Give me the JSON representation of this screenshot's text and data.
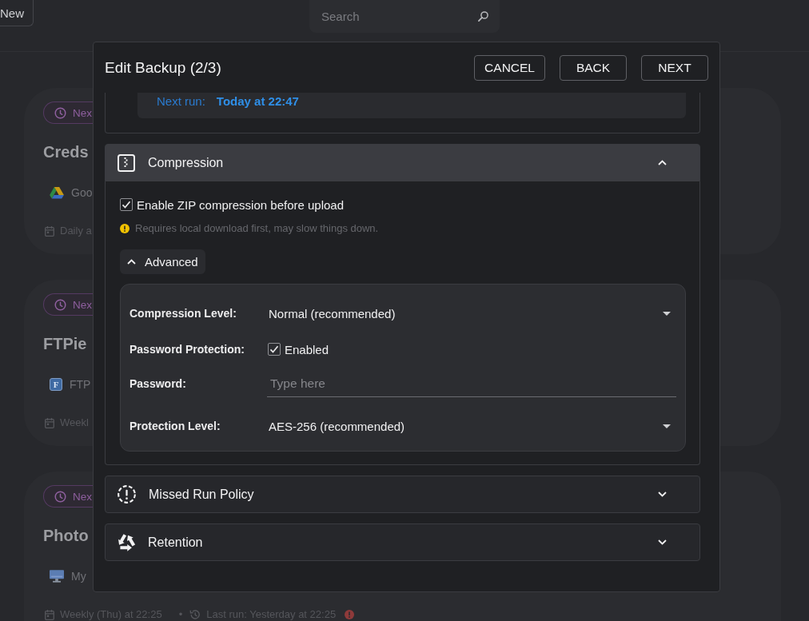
{
  "top_bar": {
    "new_button": "New",
    "search": {
      "placeholder": "Search"
    }
  },
  "background_cards": [
    {
      "badge": "Nex",
      "title": "Creds",
      "source": {
        "kind": "drive",
        "label": "Goo"
      },
      "schedule": "Daily a"
    },
    {
      "badge": "Nex",
      "title": "FTPie",
      "source": {
        "kind": "ftp",
        "label": "FTP",
        "logo_text": "F"
      },
      "schedule": "Weekl"
    },
    {
      "badge": "Nex",
      "title": "Photo",
      "source": {
        "kind": "computer",
        "label": "My"
      },
      "schedule": "Weekly (Thu) at 22:25",
      "separator": "•",
      "last_run": "Last run: Yesterday at 22:25",
      "last_run_failed": true
    }
  ],
  "dialog": {
    "title": "Edit Backup (2/3)",
    "buttons": [
      "CANCEL",
      "BACK",
      "NEXT"
    ],
    "previous_section": {
      "next_run": {
        "label": "Next run:",
        "value": "Today at 22:47"
      }
    },
    "sections": [
      {
        "kind": "compression",
        "title": "Compression",
        "expanded": true,
        "enable": {
          "label": "Enable ZIP compression before upload",
          "checked": true
        },
        "hint": "Requires local download first, may slow things down.",
        "advanced": {
          "label": "Advanced",
          "expanded": true,
          "fields": [
            {
              "kind": "select",
              "label": "Compression Level:",
              "value": "Normal (recommended)"
            },
            {
              "kind": "checkbox",
              "label": "Password Protection:",
              "option": "Enabled",
              "checked": true
            },
            {
              "kind": "text",
              "label": "Password:",
              "placeholder": "Type here"
            },
            {
              "kind": "select",
              "label": "Protection Level:",
              "value": "AES-256 (recommended)"
            }
          ]
        }
      },
      {
        "kind": "missed",
        "title": "Missed Run Policy",
        "expanded": false
      },
      {
        "kind": "retention",
        "title": "Retention",
        "expanded": false
      }
    ]
  }
}
